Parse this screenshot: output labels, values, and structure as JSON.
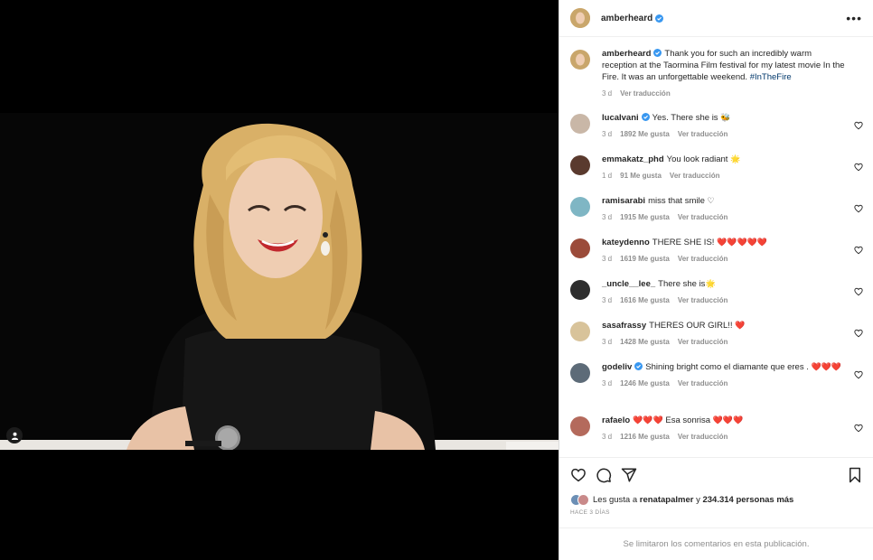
{
  "post": {
    "username": "amberheard",
    "caption": "Thank you for such an incredibly warm reception at the Taormina Film festival for my latest movie In the Fire. It was an unforgettable weekend.",
    "hashtag": "#InTheFire",
    "age": "3 d",
    "translate": "Ver traducción"
  },
  "comments": [
    {
      "user": "lucalvani",
      "verified": true,
      "text": "Yes. There she is",
      "emoji": "🐝",
      "age": "3 d",
      "likes": "1892 Me gusta",
      "translate": "Ver traducción",
      "avatar_color": "#c9b7a7"
    },
    {
      "user": "emmakatz_phd",
      "verified": false,
      "text": "You look radiant",
      "emoji": "🌟",
      "age": "1 d",
      "likes": "91 Me gusta",
      "translate": "Ver traducción",
      "avatar_color": "#5a3a2e"
    },
    {
      "user": "ramisarabi",
      "verified": false,
      "text": "miss that smile",
      "emoji": "♡",
      "age": "3 d",
      "likes": "1915 Me gusta",
      "translate": "Ver traducción",
      "avatar_color": "#7fb6c4"
    },
    {
      "user": "kateydenno",
      "verified": false,
      "text": "THERE SHE IS!",
      "emoji": "❤️❤️❤️❤️❤️",
      "age": "3 d",
      "likes": "1619 Me gusta",
      "translate": "Ver traducción",
      "avatar_color": "#9b4b3a"
    },
    {
      "user": "_uncle__lee_",
      "verified": false,
      "text": "There she is",
      "emoji": "🌟",
      "age": "3 d",
      "likes": "1616 Me gusta",
      "translate": "Ver traducción",
      "avatar_color": "#2e2e2e"
    },
    {
      "user": "sasafrassy",
      "verified": false,
      "text": "THERES OUR GIRL!!",
      "emoji": "❤️",
      "age": "3 d",
      "likes": "1428 Me gusta",
      "translate": "Ver traducción",
      "avatar_color": "#d8c39a"
    },
    {
      "user": "godeliv",
      "verified": true,
      "text": "Shining bright como el diamante que eres .",
      "emoji": "❤️❤️❤️",
      "age": "3 d",
      "likes": "1246 Me gusta",
      "translate": "Ver traducción",
      "avatar_color": "#5d6b78"
    },
    {
      "user": "rafaelo",
      "verified": false,
      "text": "Esa sonrisa",
      "emoji_before": "❤️❤️❤️",
      "emoji": "❤️❤️❤️",
      "age": "3 d",
      "likes": "1216 Me gusta",
      "translate": "Ver traducción",
      "avatar_color": "#b46a5c"
    }
  ],
  "likes_line": {
    "prefix": "Les gusta a",
    "user": "renatapalmer",
    "joiner": "y",
    "count": "234.314 personas más"
  },
  "when": "HACE 3 DÍAS",
  "comments_closed": "Se limitaron los comentarios en esta publicación.",
  "colors": {
    "verified": "#3897f0",
    "heart": "#ed4956"
  }
}
